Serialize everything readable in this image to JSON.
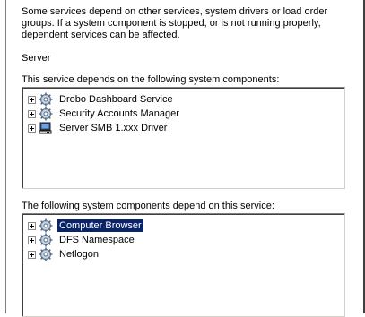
{
  "description_lines": [
    "Some services depend on other services, system drivers or load order",
    "groups. If a system component is stopped, or is not running properly,",
    "dependent services can be affected."
  ],
  "service_name": "Server",
  "depends_on": {
    "label": "This service depends on the following system components:",
    "items": [
      {
        "label": "Drobo Dashboard Service",
        "icon": "gear-icon"
      },
      {
        "label": "Security Accounts Manager",
        "icon": "gear-icon"
      },
      {
        "label": "Server SMB 1.xxx Driver",
        "icon": "driver-icon"
      }
    ]
  },
  "depended_by": {
    "label": "The following system components depend on this service:",
    "items": [
      {
        "label": "Computer Browser",
        "icon": "gear-icon",
        "selected": true
      },
      {
        "label": "DFS Namespace",
        "icon": "gear-icon"
      },
      {
        "label": "Netlogon",
        "icon": "gear-icon"
      }
    ]
  },
  "colors": {
    "selection_bg": "#0a246a",
    "selection_fg": "#ffffff"
  }
}
